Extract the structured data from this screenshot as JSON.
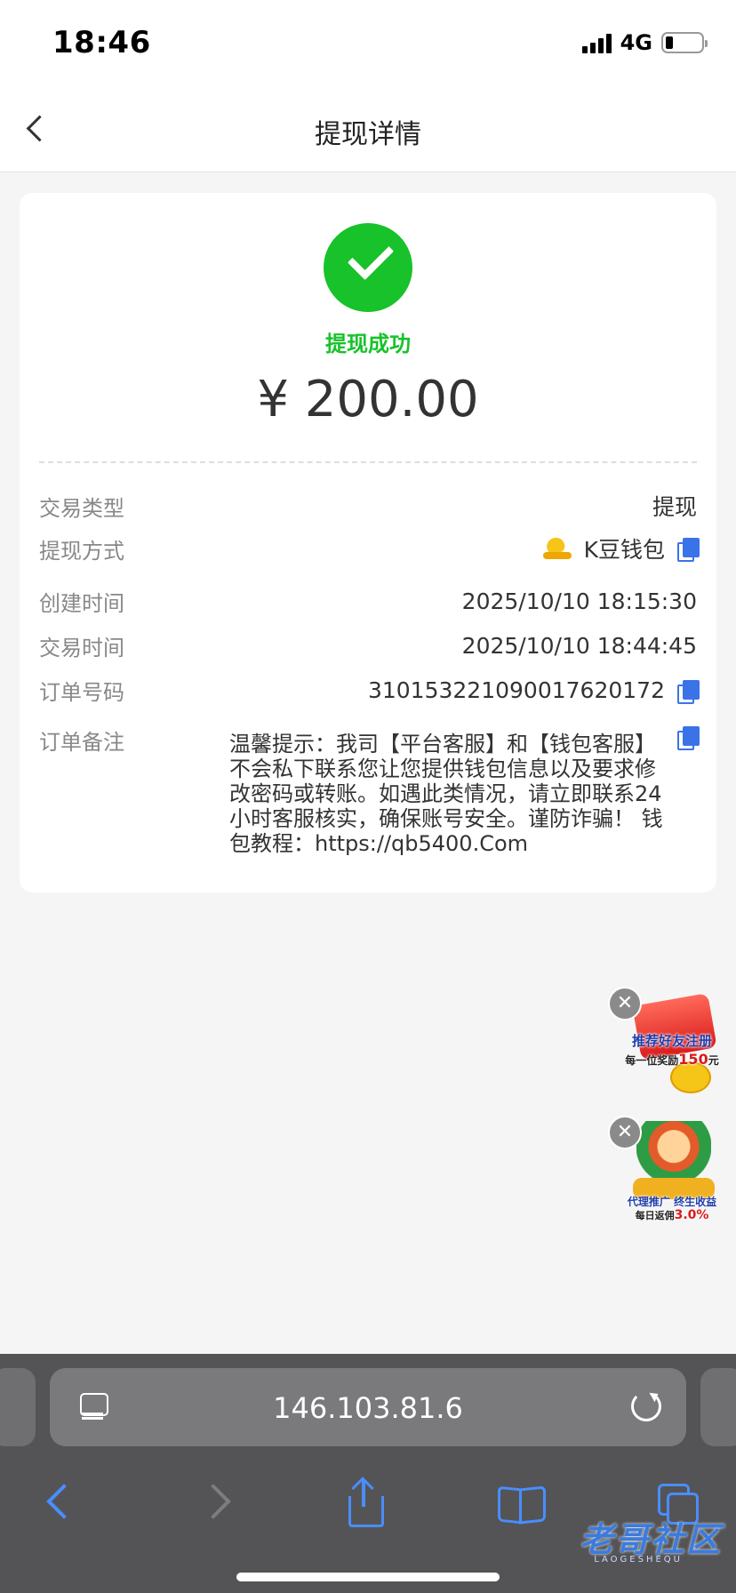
{
  "status_bar": {
    "time": "18:46",
    "network": "4G"
  },
  "header": {
    "title": "提现详情"
  },
  "summary": {
    "status": "提现成功",
    "amount": "¥ 200.00"
  },
  "details": {
    "type": {
      "label": "交易类型",
      "value": "提现"
    },
    "method": {
      "label": "提现方式",
      "value": "K豆钱包"
    },
    "created": {
      "label": "创建时间",
      "value": "2025/10/10 18:15:30"
    },
    "traded": {
      "label": "交易时间",
      "value": "2025/10/10 18:44:45"
    },
    "order_no": {
      "label": "订单号码",
      "value": "3101532210900176201​72"
    },
    "remark": {
      "label": "订单备注",
      "value": "温馨提示：我司【平台客服】和【钱包客服】不会私下联系您让您提供钱包信息以及要求修改密码或转账。如遇此类情况，请立即联系24小时客服核实，确保账号安全。谨防诈骗！ 钱包教程：https://qb5400.Com"
    }
  },
  "promos": {
    "referral": {
      "title": "推荐好友注册",
      "sub_prefix": "每一位奖励",
      "sub_amount": "150",
      "sub_suffix": "元"
    },
    "agent": {
      "title": "代理推广 终生收益",
      "sub_prefix": "每日返佣",
      "sub_amount": "3.0%"
    }
  },
  "browser": {
    "url": "146.103.81.6"
  },
  "watermark": {
    "text": "老哥社区",
    "sub": "LAOGESHEQU"
  },
  "colors": {
    "success": "#17c22a",
    "link_blue": "#3a73e8",
    "browser_bg": "#545456"
  }
}
